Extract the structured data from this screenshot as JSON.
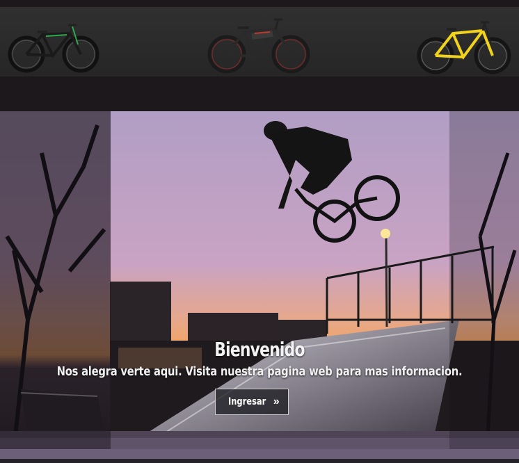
{
  "hero": {
    "title": "Bienvenido",
    "subtitle": "Nos alegra verte aqui. Visita nuestra pagina web para mas informacion.",
    "button_label": "Ingresar",
    "button_icon": "double-chevron-right-icon"
  },
  "bikes": [
    {
      "icon": "mountain-bike-green-icon",
      "accent": "#2fa84f"
    },
    {
      "icon": "electric-bike-red-icon",
      "accent": "#c0392b"
    },
    {
      "icon": "mountain-bike-yellow-icon",
      "accent": "#f2d31b"
    }
  ],
  "colors": {
    "page_background": "#1c181b",
    "bike_bar": "#2b2b2b",
    "sky_top": "#b6a1c8",
    "sky_bottom": "#f3a45a"
  }
}
